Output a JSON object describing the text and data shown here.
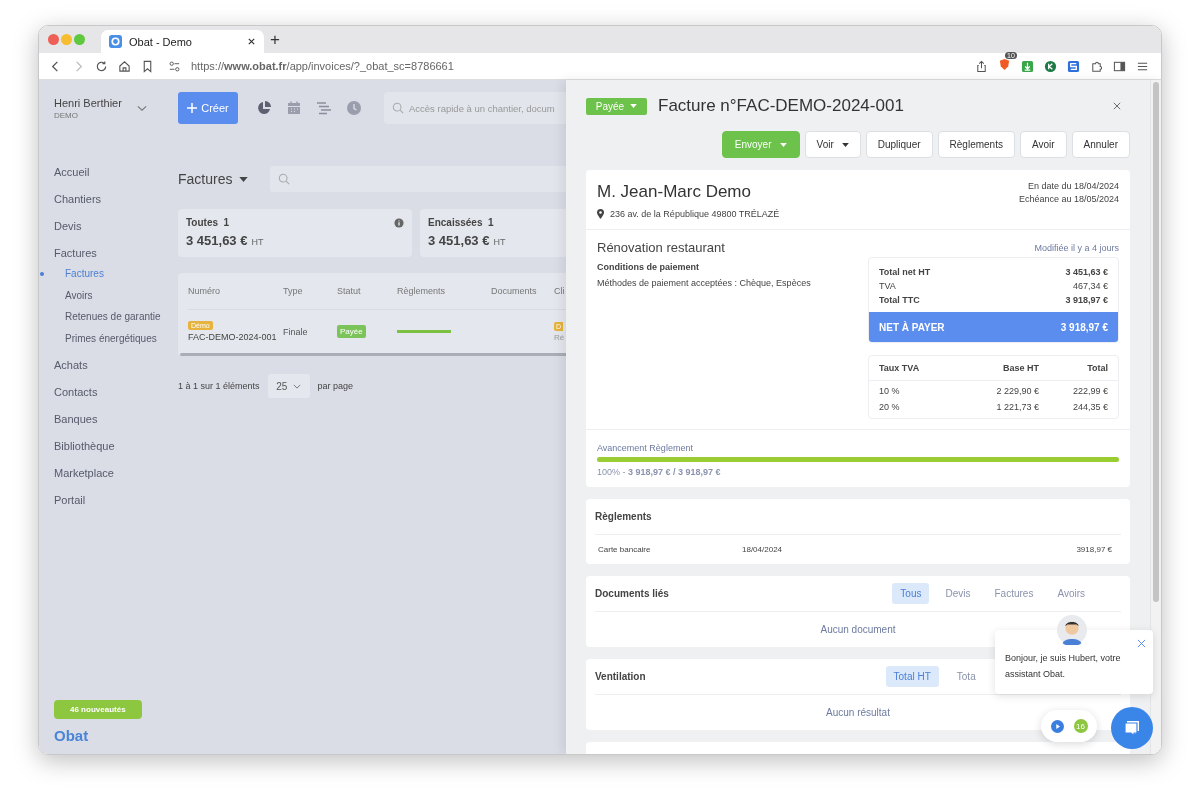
{
  "browser": {
    "tab_title": "Obat - Demo",
    "new_tab": "+",
    "url": "https://**www.obat.fr**/app/invoices/?_obat_sc=8786661",
    "extension_badge": "10"
  },
  "user": {
    "name": "Henri Berthier",
    "company": "DEMO"
  },
  "create_button": "Créer",
  "quick_search": {
    "placeholder": "Accès rapide à un chantier, docum"
  },
  "sidebar": {
    "items": [
      {
        "label": "Accueil",
        "selected": false
      },
      {
        "label": "Chantiers",
        "selected": false
      },
      {
        "label": "Devis",
        "selected": false
      },
      {
        "label": "Factures",
        "selected": false,
        "children": [
          {
            "label": "Factures",
            "selected": true
          },
          {
            "label": "Avoirs",
            "selected": false
          },
          {
            "label": "Retenues de garantie",
            "selected": false
          },
          {
            "label": "Primes énergétiques",
            "selected": false
          }
        ]
      },
      {
        "label": "Achats",
        "selected": false
      },
      {
        "label": "Contacts",
        "selected": false
      },
      {
        "label": "Banques",
        "selected": false
      },
      {
        "label": "Bibliothèque",
        "selected": false
      },
      {
        "label": "Marketplace",
        "selected": false
      },
      {
        "label": "Portail",
        "selected": false
      }
    ],
    "news_badge": "46 nouveautés",
    "logo": "Obat"
  },
  "list": {
    "title": "Factures",
    "summary_cards": [
      {
        "label": "Toutes",
        "count": "1",
        "amount": "3 451,63 €",
        "unit": "HT"
      },
      {
        "label": "Encaissées",
        "count": "1",
        "amount": "3 451,63 €",
        "unit": "HT"
      }
    ],
    "table": {
      "columns": [
        "Numéro",
        "Type",
        "Statut",
        "Règlements",
        "Documents",
        "Cli"
      ],
      "rows": [
        {
          "tag": "Démo",
          "number": "FAC-DEMO-2024-001",
          "type": "Finale",
          "status": "Payée",
          "level": 1,
          "client_tag": "D",
          "client_sub": "Ré"
        }
      ]
    },
    "pagination": {
      "range": "1 à 1 sur 1 éléments",
      "page_size": "25",
      "suffix": "par page"
    }
  },
  "invoice": {
    "status": "Payée",
    "title": "Facture n°FAC-DEMO-2024-001",
    "actions": [
      {
        "label": "Envoyer",
        "kind": "primary",
        "dropdown": true
      },
      {
        "label": "Voir",
        "kind": "default",
        "dropdown": true
      },
      {
        "label": "Dupliquer",
        "kind": "default",
        "dropdown": false
      },
      {
        "label": "Règlements",
        "kind": "default",
        "dropdown": false
      },
      {
        "label": "Avoir",
        "kind": "default",
        "dropdown": false
      },
      {
        "label": "Annuler",
        "kind": "default",
        "dropdown": false
      }
    ],
    "client": "M. Jean-Marc Demo",
    "address": "236 av. de la République 49800 TRÉLAZÉ",
    "dates": [
      "En date du 18/04/2024",
      "Echéance au 18/05/2024"
    ],
    "project": "Rénovation restaurant",
    "modified": "Modifiée il y a 4 jours",
    "conditions_title": "Conditions de paiement",
    "conditions": "Méthodes de paiement acceptées : Chèque, Espèces",
    "totals": [
      {
        "label": "Total net HT",
        "value": "3 451,63 €",
        "bold": true
      },
      {
        "label": "TVA",
        "value": "467,34 €",
        "bold": false
      },
      {
        "label": "Total TTC",
        "value": "3 918,97 €",
        "bold": true
      }
    ],
    "net_to_pay": {
      "label": "NET À PAYER",
      "value": "3 918,97 €"
    },
    "vat_table": {
      "columns": [
        "Taux TVA",
        "Base HT",
        "Total"
      ],
      "rows": [
        [
          "10 %",
          "2 229,90 €",
          "222,99 €"
        ],
        [
          "20 %",
          "1 221,73 €",
          "244,35 €"
        ]
      ]
    },
    "progress": {
      "title": "Avancement Règlement",
      "level": 1,
      "summary": "100% - **3 918,97 € / 3 918,97 €**"
    }
  },
  "payments": {
    "title": "Règlements",
    "rows": [
      {
        "method": "Carte bancaire",
        "date": "18/04/2024",
        "amount": "3918,97 €"
      }
    ]
  },
  "linked_documents": {
    "title": "Documents liés",
    "filters": [
      {
        "label": "Tous",
        "selected": true
      },
      {
        "label": "Devis",
        "selected": false
      },
      {
        "label": "Factures",
        "selected": false
      },
      {
        "label": "Avoirs",
        "selected": false
      }
    ],
    "empty": "Aucun document"
  },
  "ventilation": {
    "title": "Ventilation",
    "filters": [
      {
        "label": "Total HT",
        "selected": true
      },
      {
        "label": "Tota",
        "selected": false
      }
    ],
    "empty": "Aucun résultat"
  },
  "chat": {
    "message": "Bonjour, je suis Hubert, votre assistant Obat.",
    "badge": "16"
  }
}
